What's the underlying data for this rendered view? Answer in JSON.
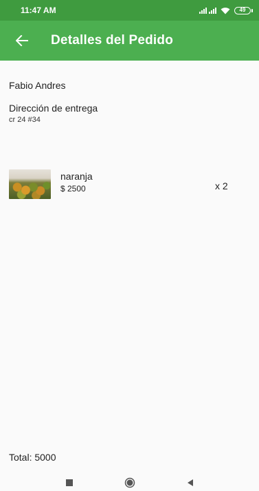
{
  "status_bar": {
    "time": "11:47 AM",
    "battery": "49"
  },
  "app_bar": {
    "title": "Detalles del Pedido"
  },
  "order": {
    "customer_name": "Fabio Andres",
    "address_label": "Dirección de entrega",
    "address": "cr 24 #34",
    "items": [
      {
        "name": "naranja",
        "price": "$ 2500",
        "quantity": "x 2",
        "image": "orange-product-image"
      }
    ],
    "total": "Total: 5000"
  },
  "colors": {
    "status_bar": "#3f9b3f",
    "app_bar": "#4caf50",
    "background": "#fafafa"
  },
  "icons": {
    "back": "arrow-left-icon",
    "wifi": "wifi-icon",
    "signal": "signal-icon",
    "battery": "battery-icon",
    "nav_recent": "square-icon",
    "nav_home": "circle-icon",
    "nav_back": "triangle-icon"
  }
}
